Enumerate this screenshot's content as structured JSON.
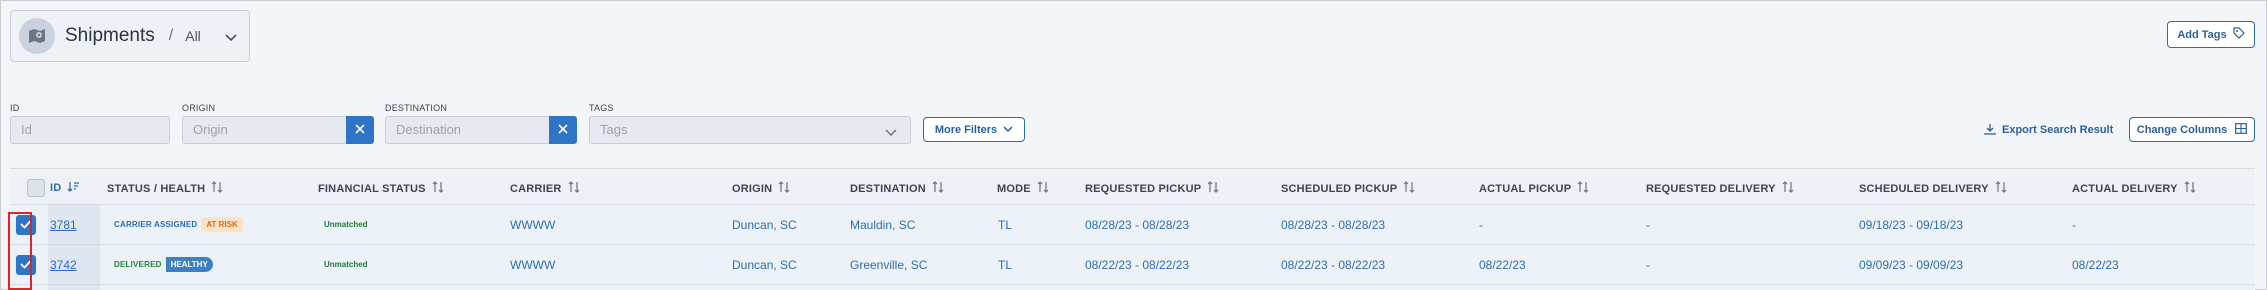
{
  "header": {
    "title": "Shipments",
    "separator": "/",
    "view": "All",
    "add_tags_label": "Add Tags"
  },
  "filters": {
    "id": {
      "label": "ID",
      "placeholder": "Id"
    },
    "origin": {
      "label": "ORIGIN",
      "placeholder": "Origin"
    },
    "destination": {
      "label": "DESTINATION",
      "placeholder": "Destination"
    },
    "tags": {
      "label": "TAGS",
      "placeholder": "Tags"
    },
    "more_filters_label": "More Filters",
    "export_label": "Export Search Result",
    "change_columns_label": "Change Columns"
  },
  "table": {
    "columns": {
      "id": "ID",
      "status": "STATUS / HEALTH",
      "financial": "FINANCIAL STATUS",
      "carrier": "CARRIER",
      "origin": "ORIGIN",
      "destination": "DESTINATION",
      "mode": "MODE",
      "requested_pickup": "REQUESTED PICKUP",
      "scheduled_pickup": "SCHEDULED PICKUP",
      "actual_pickup": "ACTUAL PICKUP",
      "requested_delivery": "REQUESTED DELIVERY",
      "scheduled_delivery": "SCHEDULED DELIVERY",
      "actual_delivery": "ACTUAL DELIVERY"
    },
    "rows": [
      {
        "checked": true,
        "id": "3781",
        "status": "CARRIER ASSIGNED",
        "health": "AT RISK",
        "financial": "Unmatched",
        "carrier": "WWWW",
        "origin": "Duncan, SC",
        "destination": "Mauldin, SC",
        "mode": "TL",
        "requested_pickup": "08/28/23 - 08/28/23",
        "scheduled_pickup": "08/28/23 - 08/28/23",
        "actual_pickup": "-",
        "requested_delivery": "-",
        "scheduled_delivery": "09/18/23 - 09/18/23",
        "actual_delivery": "-"
      },
      {
        "checked": true,
        "id": "3742",
        "status": "DELIVERED",
        "health": "HEALTHY",
        "financial": "Unmatched",
        "carrier": "WWWW",
        "origin": "Duncan, SC",
        "destination": "Greenville, SC",
        "mode": "TL",
        "requested_pickup": "08/22/23 - 08/22/23",
        "scheduled_pickup": "08/22/23 - 08/22/23",
        "actual_pickup": "08/22/23",
        "requested_delivery": "-",
        "scheduled_delivery": "09/09/23 - 09/09/23",
        "actual_delivery": "08/22/23"
      }
    ]
  },
  "colors": {
    "accent": "#2e75c7",
    "link": "#2e6db5",
    "carrier_assigned": "#2e6db5",
    "at_risk_bg": "#fde3c4",
    "at_risk_text": "#c9731a",
    "delivered": "#1f8a3e",
    "healthy_bg": "#3f7fc4",
    "healthy_text": "#ffffff",
    "unmatched": "#1f7a3a",
    "selection_highlight": "#e02424"
  }
}
